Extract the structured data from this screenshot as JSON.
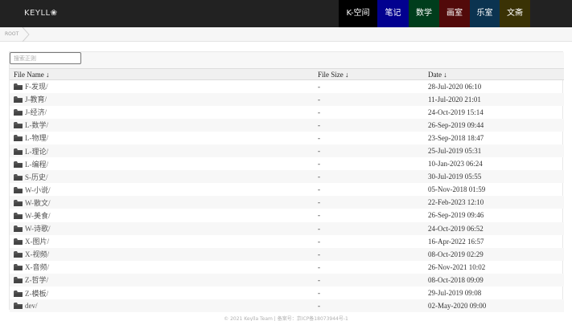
{
  "header": {
    "brand": "KEYLL❀",
    "nav": [
      "K-空间",
      "笔记",
      "数学",
      "画室",
      "乐室",
      "文斋"
    ]
  },
  "breadcrumb": {
    "root": "ROOT"
  },
  "search": {
    "placeholder": "搜索正则",
    "value": ""
  },
  "table": {
    "headers": {
      "name": "File Name  ↓",
      "size": "File Size  ↓",
      "date": "Date  ↓"
    },
    "rows": [
      {
        "name": "F-发现/",
        "size": "-",
        "date": "28-Jul-2020 06:10"
      },
      {
        "name": "J-教育/",
        "size": "-",
        "date": "11-Jul-2020 21:01"
      },
      {
        "name": "J-经济/",
        "size": "-",
        "date": "24-Oct-2019 15:14"
      },
      {
        "name": "L-数学/",
        "size": "-",
        "date": "26-Sep-2019 09:44"
      },
      {
        "name": "L-物理/",
        "size": "-",
        "date": "23-Sep-2018 18:47"
      },
      {
        "name": "L-理论/",
        "size": "-",
        "date": "25-Jul-2019 05:31"
      },
      {
        "name": "L-编程/",
        "size": "-",
        "date": "10-Jan-2023 06:24"
      },
      {
        "name": "S-历史/",
        "size": "-",
        "date": "30-Jul-2019 05:55"
      },
      {
        "name": "W-小说/",
        "size": "-",
        "date": "05-Nov-2018 01:59"
      },
      {
        "name": "W-散文/",
        "size": "-",
        "date": "22-Feb-2023 12:10"
      },
      {
        "name": "W-美食/",
        "size": "-",
        "date": "26-Sep-2019 09:46"
      },
      {
        "name": "W-诗歌/",
        "size": "-",
        "date": "24-Oct-2019 06:52"
      },
      {
        "name": "X-图片/",
        "size": "-",
        "date": "16-Apr-2022 16:57"
      },
      {
        "name": "X-视频/",
        "size": "-",
        "date": "08-Oct-2019 02:29"
      },
      {
        "name": "X-音频/",
        "size": "-",
        "date": "26-Nov-2021 10:02"
      },
      {
        "name": "Z-哲学/",
        "size": "-",
        "date": "08-Oct-2018 09:09"
      },
      {
        "name": "Z-模板/",
        "size": "-",
        "date": "29-Jul-2019 09:08"
      },
      {
        "name": "dev/",
        "size": "-",
        "date": "02-May-2020 09:00"
      }
    ]
  },
  "footer": {
    "text": "© 2021 Keylla Team  |  备案号：京ICP备18073944号-1"
  },
  "icons": {
    "folder": "folder-icon"
  },
  "colors": {
    "topbar": "#222222",
    "nav": [
      "#000000",
      "#02018f",
      "#003d1c",
      "#520a0a",
      "#0b3350",
      "#3a3205"
    ]
  }
}
